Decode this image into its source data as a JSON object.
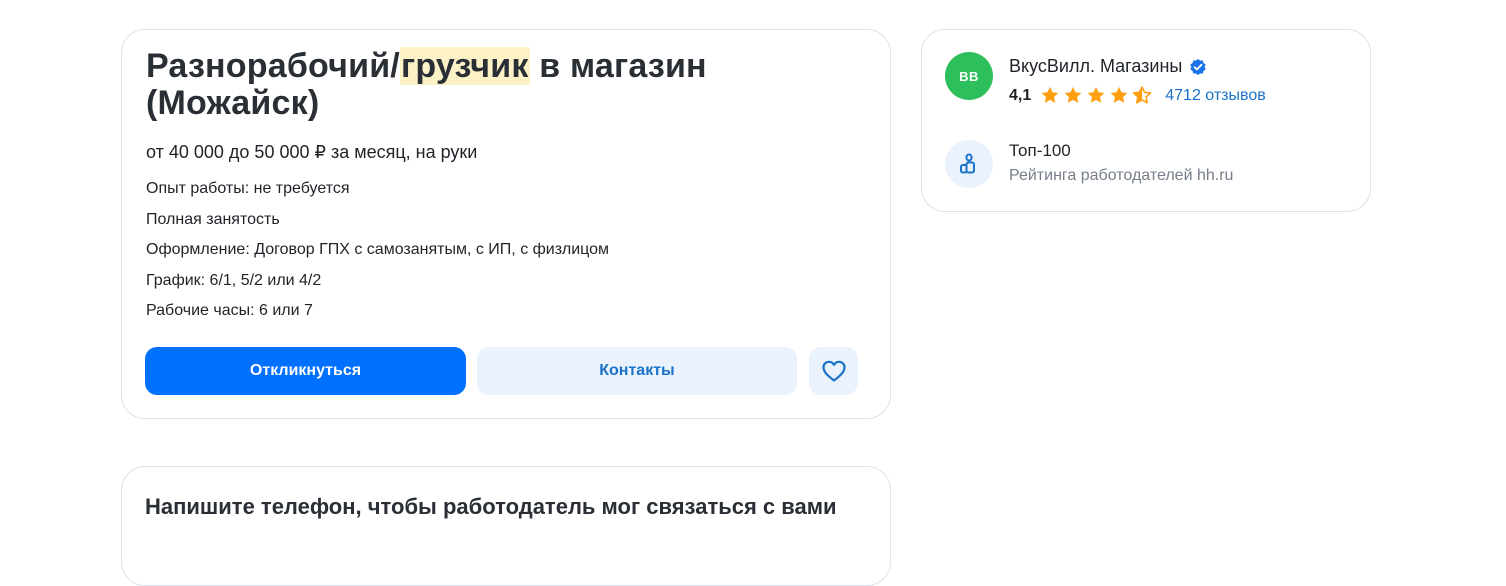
{
  "vacancy": {
    "title_before": "Разнорабочий/",
    "title_highlight": "грузчик",
    "title_after": " в магазин (Можайск)",
    "salary": "от 40 000 до 50 000 ₽ за месяц, на руки",
    "facts": [
      "Опыт работы: не требуется",
      "Полная занятость",
      "Оформление: Договор ГПХ с самозанятым, с ИП, с физлицом",
      "График: 6/1, 5/2 или 4/2",
      "Рабочие часы: 6 или 7"
    ],
    "apply_label": "Откликнуться",
    "contacts_label": "Контакты",
    "favorite_icon": "heart-icon"
  },
  "employer": {
    "avatar_initials": "ВВ",
    "name": "ВкусВилл. Магазины",
    "verified_icon": "verified-check-icon",
    "rating_value": "4,1",
    "rating_stars": 4.1,
    "reviews_label": "4712 отзывов",
    "top_title": "Топ-100",
    "top_subtitle": "Рейтинга работодателей hh.ru"
  },
  "phone_section": {
    "title": "Напишите телефон, чтобы работодатель мог связаться с вами"
  },
  "colors": {
    "primary": "#0070ff",
    "secondary_bg": "#eaf3fd",
    "link": "#1a73c9",
    "star": "#ff9f0f",
    "highlight": "#fdf1c7",
    "avatar": "#2cbf5c"
  }
}
